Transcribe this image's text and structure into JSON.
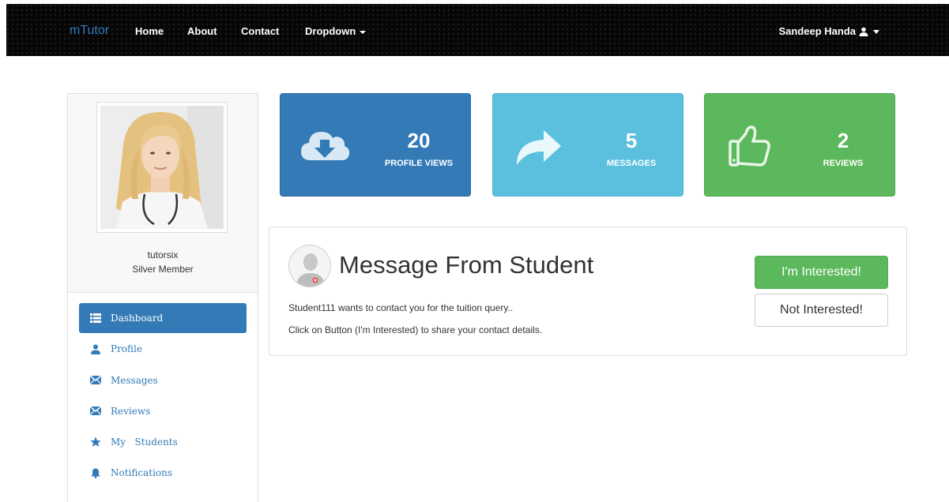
{
  "navbar": {
    "brand": "mTutor",
    "links": [
      "Home",
      "About",
      "Contact",
      "Dropdown"
    ],
    "user": "Sandeep Handa"
  },
  "profile": {
    "username": "tutorsix",
    "membership": "Silver Member"
  },
  "sidebar": {
    "items": [
      {
        "label": "Dashboard",
        "icon": "list-icon",
        "active": true
      },
      {
        "label": "Profile",
        "icon": "user-icon"
      },
      {
        "label": "Messages",
        "icon": "envelope-icon"
      },
      {
        "label": "Reviews",
        "icon": "envelope-icon"
      },
      {
        "label": "My   Students",
        "icon": "star-icon"
      },
      {
        "label": "Notifications",
        "icon": "bell-icon"
      }
    ]
  },
  "stats": {
    "views": {
      "value": "20",
      "label": "PROFILE VIEWS",
      "icon": "cloud-download-icon"
    },
    "messages": {
      "value": "5",
      "label": "MESSAGES",
      "icon": "share-arrow-icon"
    },
    "reviews": {
      "value": "2",
      "label": "REVIEWS",
      "icon": "thumbs-up-icon"
    }
  },
  "message_panel": {
    "title": "Message From Student",
    "line1": "Student111 wants to contact you for the tuition query..",
    "line2": "Click on Button (I'm Interested) to share your contact details.",
    "interested_label": "I'm Interested!",
    "not_interested_label": "Not Interested!"
  },
  "colors": {
    "primary": "#337ab7",
    "info": "#5bc0de",
    "success": "#5cb85c"
  }
}
